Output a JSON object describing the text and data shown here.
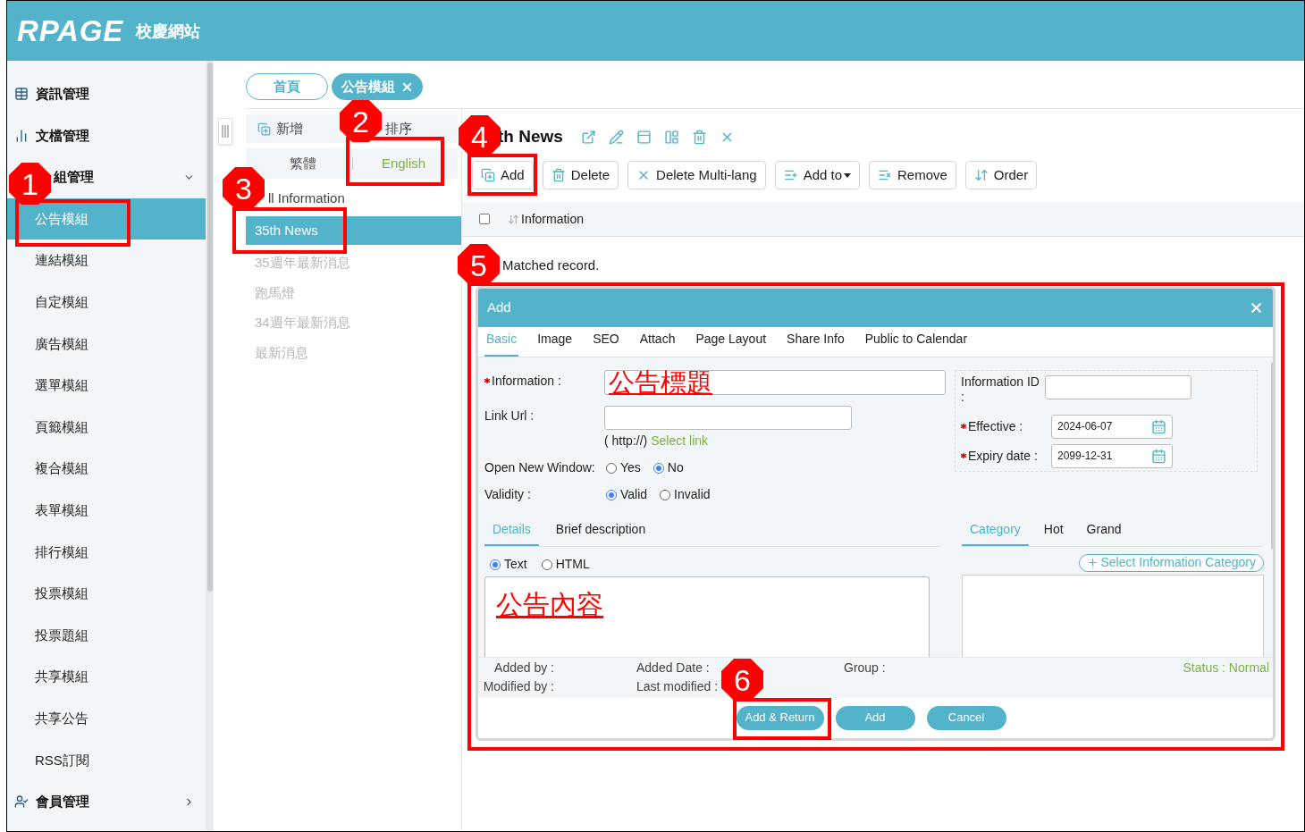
{
  "header": {
    "logo": "RPAGE",
    "site_name": "校慶網站"
  },
  "sidebar": {
    "sections": [
      {
        "label": "資訊管理"
      },
      {
        "label": "文檔管理"
      },
      {
        "label": "組管理",
        "expanded": true,
        "children": [
          {
            "label": "公告模組",
            "selected": true
          },
          {
            "label": "連結模組",
            "selected": false
          },
          {
            "label": "自定模組",
            "selected": false
          },
          {
            "label": "廣告模組",
            "selected": false
          },
          {
            "label": "選單模組",
            "selected": false
          },
          {
            "label": "頁籤模組",
            "selected": false
          },
          {
            "label": "複合模組",
            "selected": false
          },
          {
            "label": "表單模組",
            "selected": false
          },
          {
            "label": "排行模組",
            "selected": false
          },
          {
            "label": "投票模組",
            "selected": false
          },
          {
            "label": "投票題組",
            "selected": false
          },
          {
            "label": "共享模組",
            "selected": false
          },
          {
            "label": "共享公告",
            "selected": false
          },
          {
            "label": "RSS訂閱",
            "selected": false
          }
        ]
      },
      {
        "label": "會員管理",
        "expanded": false
      }
    ]
  },
  "page_tabs": [
    {
      "label": "首頁",
      "selected": false,
      "closable": false
    },
    {
      "label": "公告模組",
      "selected": true,
      "closable": true
    }
  ],
  "module_panel": {
    "actions": [
      "新增",
      "排序"
    ],
    "languages": [
      {
        "label": "繁體",
        "selected": false
      },
      {
        "label": "English",
        "selected": true
      }
    ],
    "root": "ll Information",
    "items": [
      {
        "label": "35th News",
        "selected": true,
        "disabled": false
      },
      {
        "label": "35週年最新消息",
        "selected": false,
        "disabled": true
      },
      {
        "label": "跑馬燈",
        "selected": false,
        "disabled": true
      },
      {
        "label": "34週年最新消息",
        "selected": false,
        "disabled": true
      },
      {
        "label": "最新消息",
        "selected": false,
        "disabled": true
      }
    ]
  },
  "content": {
    "title": "th News",
    "toolbar": [
      {
        "label": "Add",
        "kind": "button"
      },
      {
        "label": "Delete",
        "kind": "button"
      },
      {
        "label": "Delete Multi-lang",
        "kind": "button"
      },
      {
        "label": "Add to",
        "kind": "dropdown"
      },
      {
        "label": "Remove",
        "kind": "button"
      },
      {
        "label": "Order",
        "kind": "button"
      }
    ],
    "table": {
      "columns": [
        "Information"
      ],
      "checked": false
    },
    "message": "Matched record."
  },
  "dialog": {
    "title": "Add",
    "tabs": [
      {
        "label": "Basic",
        "selected": true
      },
      {
        "label": "Image",
        "selected": false
      },
      {
        "label": "SEO",
        "selected": false
      },
      {
        "label": "Attach",
        "selected": false
      },
      {
        "label": "Page Layout",
        "selected": false
      },
      {
        "label": "Share Info",
        "selected": false
      },
      {
        "label": "Public to Calendar",
        "selected": false
      }
    ],
    "information": {
      "label": "Information :",
      "required": true,
      "value": "公告標題"
    },
    "link_url": {
      "label": "Link Url :",
      "hint": "( http://)",
      "link": "Select link"
    },
    "open_new_window": {
      "label": "Open New Window:",
      "options": [
        {
          "label": "Yes",
          "selected": false
        },
        {
          "label": "No",
          "selected": true
        }
      ]
    },
    "validity": {
      "label": "Validity :",
      "options": [
        {
          "label": "Valid",
          "selected": true
        },
        {
          "label": "Invalid",
          "selected": false
        }
      ]
    },
    "information_id": {
      "label": "Information ID :"
    },
    "effective": {
      "label": "Effective :",
      "required": true,
      "value": "2024-06-07"
    },
    "expiry": {
      "label": "Expiry date :",
      "required": true,
      "value": "2099-12-31"
    },
    "content_tabs": [
      {
        "label": "Details",
        "selected": true
      },
      {
        "label": "Brief description",
        "selected": false
      }
    ],
    "formats": [
      {
        "label": "Text",
        "selected": true
      },
      {
        "label": "HTML",
        "selected": false
      }
    ],
    "content_value": "公告內容",
    "category_tabs": [
      {
        "label": "Category",
        "selected": true
      },
      {
        "label": "Hot",
        "selected": false
      },
      {
        "label": "Grand",
        "selected": false
      }
    ],
    "category_button": "Select Information Category",
    "meta_rows": [
      [
        "Added by :",
        "Added Date :",
        "Group :"
      ],
      [
        "Modified by :",
        "Last modified :"
      ]
    ],
    "status": "Status : Normal",
    "buttons": [
      "Add & Return",
      "Add",
      "Cancel"
    ]
  },
  "annotations": [
    {
      "number": "1"
    },
    {
      "number": "2"
    },
    {
      "number": "3"
    },
    {
      "number": "4"
    },
    {
      "number": "5"
    },
    {
      "number": "6"
    }
  ]
}
